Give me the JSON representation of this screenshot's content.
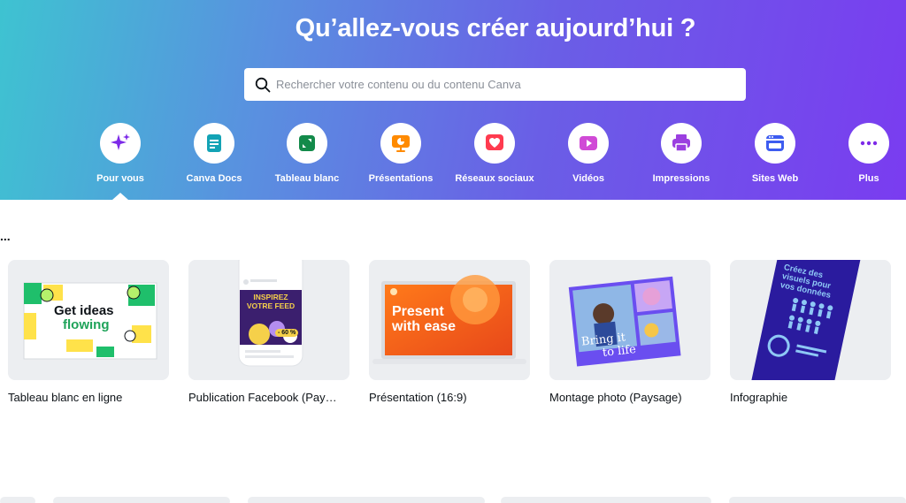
{
  "hero": {
    "title": "Qu’allez-vous créer aujourd’hui ?",
    "search_placeholder": "Rechercher votre contenu ou du contenu Canva"
  },
  "categories": [
    {
      "label": "Pour vous",
      "icon": "sparkle-icon",
      "color": "#7d2ae8",
      "selected": true
    },
    {
      "label": "Canva Docs",
      "icon": "doc-icon",
      "color": "#13a3b5"
    },
    {
      "label": "Tableau blanc",
      "icon": "whiteboard-icon",
      "color": "#138a4a"
    },
    {
      "label": "Présentations",
      "icon": "presentation-icon",
      "color": "#ff8a00"
    },
    {
      "label": "Réseaux sociaux",
      "icon": "heart-icon",
      "color": "#ff3b4f"
    },
    {
      "label": "Vidéos",
      "icon": "video-icon",
      "color": "#d04ad6"
    },
    {
      "label": "Impressions",
      "icon": "printer-icon",
      "color": "#9b3fe0"
    },
    {
      "label": "Sites Web",
      "icon": "browser-icon",
      "color": "#3d5cf0"
    },
    {
      "label": "Plus",
      "icon": "more-icon",
      "color": "#7d2ae8"
    }
  ],
  "section": {
    "label": "..."
  },
  "cards": [
    {
      "name": "Tableau blanc en ligne",
      "thumb_text": [
        "Get ideas",
        "flowing"
      ]
    },
    {
      "name": "Publication Facebook (Pay…",
      "thumb_text": [
        "INSPIREZ",
        "VOTRE FEED",
        "- 60 %"
      ]
    },
    {
      "name": "Présentation (16:9)",
      "thumb_text": [
        "Present",
        "with ease"
      ]
    },
    {
      "name": "Montage photo (Paysage)",
      "thumb_text": [
        "Bring it",
        "to life"
      ]
    },
    {
      "name": "Infographie",
      "thumb_text": [
        "Créez des",
        "visuels pour",
        "vos données"
      ]
    }
  ]
}
